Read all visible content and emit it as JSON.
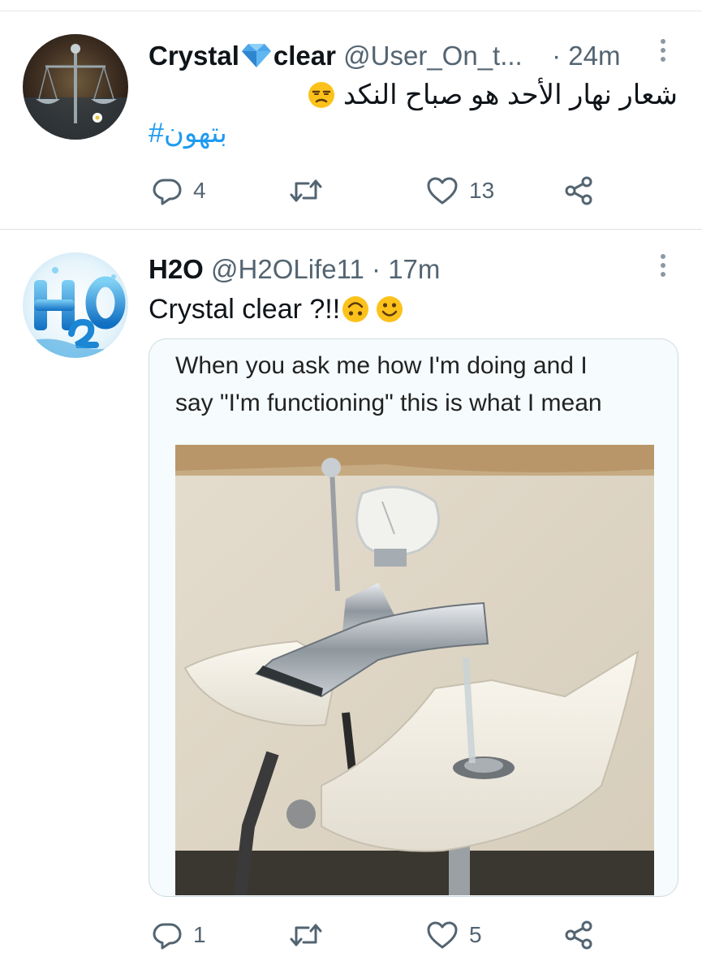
{
  "tweets": [
    {
      "name_part1": "Crystal",
      "name_part2": "clear",
      "handle": "@User_On_t...",
      "separator": "·",
      "time": "24m",
      "text": "شعار نهار الأحد هو صباح النكد",
      "hashtag": "بتهون#",
      "reply_count": "4",
      "retweet_count": "",
      "like_count": "13"
    },
    {
      "name": "H2O",
      "handle": "@H2OLife11",
      "separator": "·",
      "time": "17m",
      "text": "Crystal clear ?!!",
      "quote": {
        "line1": "When you ask me how I'm doing and I",
        "line2": "say \"I'm functioning\" this is what I mean"
      },
      "reply_count": "1",
      "retweet_count": "",
      "like_count": "5"
    }
  ],
  "icons": {
    "reply": "reply-icon",
    "retweet": "retweet-icon",
    "like": "heart-icon",
    "share": "share-icon",
    "more": "more-icon"
  },
  "colors": {
    "text": "#0f1419",
    "secondary": "#536471",
    "link": "#1d9bf0",
    "divider": "#e1e1e1"
  }
}
